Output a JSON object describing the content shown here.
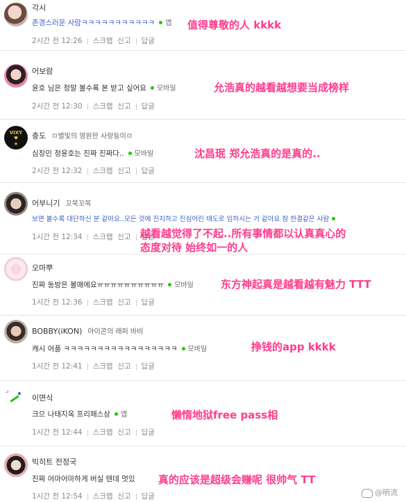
{
  "comments": [
    {
      "nickname": "각시",
      "badge": "",
      "text": "존경스러운 사람ㅋㅋㅋㅋㅋㅋㅋㅋㅋㅋㅋ",
      "text_color": "#3a62c8",
      "device": "앱",
      "time": "2시간 전  12:26",
      "scrap": "스크랩",
      "report": "신고",
      "reply": "답글",
      "translation": "值得尊敬的人 kkkk"
    },
    {
      "nickname": "어보람",
      "badge": "",
      "text": "윤호 님은 정말 볼수록 본 받고 싶어요",
      "text_color": "#333333",
      "device": "모바일",
      "time": "2시간 전  12:30",
      "scrap": "스크랩",
      "report": "신고",
      "reply": "답글",
      "translation": "允浩真的越看越想要当成榜样"
    },
    {
      "nickname": "충도",
      "badge": "ㅁ별빛의 영원한 사랑둥이ㅁ",
      "text": "심창민 정윤호는 진짜 진짜다..",
      "text_color": "#333333",
      "device": "모바일",
      "time": "2시간 전  12:32",
      "scrap": "스크랩",
      "report": "신고",
      "reply": "답글",
      "translation": "沈昌珉 郑允浩真的是真的.."
    },
    {
      "nickname": "어부니기",
      "badge": "꼬북꼬북",
      "text": "보면 볼수록 대단하신 분 같아요..모든 것에 진지하고 진심어린 태도로 임하시는 거 같아요 참 한결같은 사람",
      "text_color": "#3a62c8",
      "device": "",
      "time": "1시간 전  12:34",
      "scrap": "스크랩",
      "report": "신고",
      "reply": "답글",
      "translation": "越看越觉得了不起..所有事情都以认真真心的",
      "translation2": "态度对待 始终如一的人"
    },
    {
      "nickname": "오마뿌",
      "badge": "",
      "text": "진짜 동방은 볼매에요ㅠㅠㅠㅠㅠㅠㅠㅠㅠㅠ",
      "text_color": "#333333",
      "device": "모바일",
      "time": "1시간 전  12:36",
      "scrap": "스크랩",
      "report": "신고",
      "reply": "답글",
      "translation": "东方神起真是越看越有魅力 TTT"
    },
    {
      "nickname": "BOBBY(iKON)",
      "badge": "아이콘의 래퍼 바비",
      "text": "캐시 어플 ㅋㅋㅋㅋㅋㅋㅋㅋㅋㅋㅋㅋㅋㅋㅋㅋㅋ",
      "text_color": "#333333",
      "device": "모바일",
      "time": "1시간 전  12:41",
      "scrap": "스크랩",
      "report": "신고",
      "reply": "답글",
      "translation": "挣钱的app kkkk"
    },
    {
      "nickname": "이면식",
      "badge": "",
      "text": "크으 나태지옥 프리패스상",
      "text_color": "#333333",
      "device": "앱",
      "time": "1시간 전  12:44",
      "scrap": "스크랩",
      "report": "신고",
      "reply": "답글",
      "translation": "懒惰地狱free pass相"
    },
    {
      "nickname": "빅히트 전정국",
      "badge": "",
      "text": "진짜 어마어마하게 버실 텐데 멋있",
      "text_color": "#333333",
      "device": "",
      "time": "1시간 전  12:54",
      "scrap": "스크랩",
      "report": "신고",
      "reply": "답글",
      "translation": "真的应该是超级会赚呢 很帅气 TT"
    }
  ],
  "watermark": "@明流",
  "colors": {
    "annotation": "#ff3c8c",
    "online_dot": "#1ec800",
    "link_blue": "#3a62c8"
  }
}
